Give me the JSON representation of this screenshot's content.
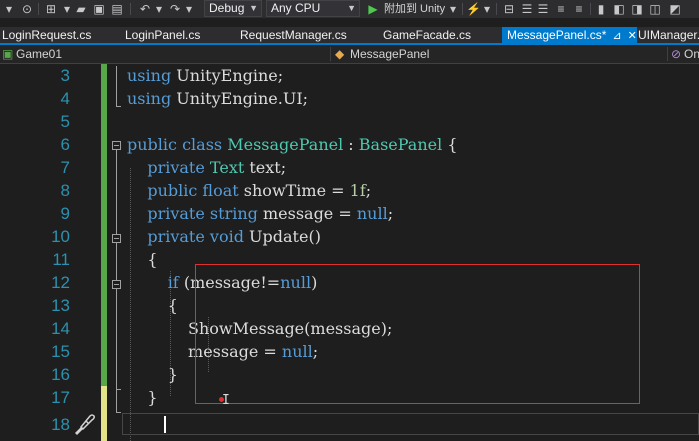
{
  "toolbar": {
    "config": "Debug",
    "platform": "Any CPU",
    "attach_label": "附加到 Unity"
  },
  "tabs": [
    {
      "label": "LoginRequest.cs"
    },
    {
      "label": "LoginPanel.cs"
    },
    {
      "label": "RequestManager.cs"
    },
    {
      "label": "GameFacade.cs"
    },
    {
      "label": "MessagePanel.cs*",
      "active": true
    },
    {
      "label": "UIManager.."
    }
  ],
  "navbar": {
    "project": "Game01",
    "class": "MessagePanel",
    "member": "On"
  },
  "code": {
    "lines": [
      {
        "num": "3",
        "text": "using UnityEngine;"
      },
      {
        "num": "4",
        "text": "using UnityEngine.UI;"
      },
      {
        "num": "5",
        "text": ""
      },
      {
        "num": "6",
        "text": "public class MessagePanel : BasePanel {"
      },
      {
        "num": "7",
        "text": "    private Text text;"
      },
      {
        "num": "8",
        "text": "    public float showTime = 1f;"
      },
      {
        "num": "9",
        "text": "    private string message = null;"
      },
      {
        "num": "10",
        "text": "    private void Update()"
      },
      {
        "num": "11",
        "text": "    {"
      },
      {
        "num": "12",
        "text": "        if (message!=null)"
      },
      {
        "num": "13",
        "text": "        {"
      },
      {
        "num": "14",
        "text": "            ShowMessage(message);"
      },
      {
        "num": "15",
        "text": "            message = null;"
      },
      {
        "num": "16",
        "text": "        }"
      },
      {
        "num": "17",
        "text": "    }"
      },
      {
        "num": "18",
        "text": ""
      }
    ]
  },
  "colors": {
    "keyword": "#569cd6",
    "type": "#4ec9b0",
    "number": "#b5cea8",
    "line_number": "#2b91af",
    "highlight_box": "#e03030",
    "active_tab": "#007acc"
  }
}
